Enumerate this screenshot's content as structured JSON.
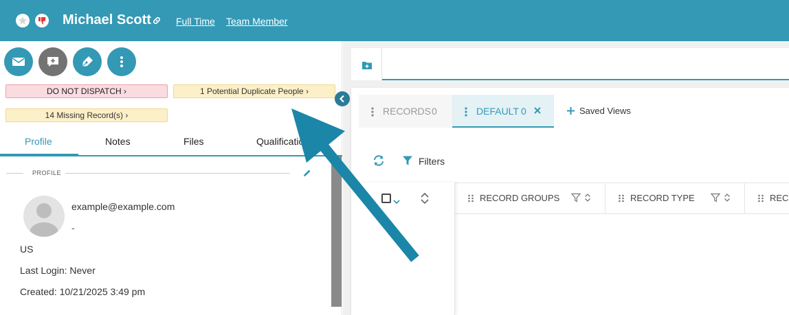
{
  "header": {
    "name": "Michael Scott",
    "employment": "Full Time",
    "role": "Team Member",
    "accent": "#3399b5"
  },
  "actions": [
    "email",
    "comment",
    "edit",
    "more"
  ],
  "badges": {
    "dispatch": "DO NOT DISPATCH",
    "duplicates": "1 Potential Duplicate People",
    "missing": "14 Missing Record(s)"
  },
  "tabs": {
    "profile": "Profile",
    "notes": "Notes",
    "files": "Files",
    "qualifications": "Qualifications"
  },
  "profile": {
    "section": "PROFILE",
    "email": "example@example.com",
    "phone": "-",
    "country": "US",
    "last_login": "Last Login: Never",
    "created": "Created: 10/21/2025 3:49 pm"
  },
  "views": {
    "records_label": "RECORDS",
    "records_count": "0",
    "default_label": "DEFAULT",
    "default_count": "0",
    "saved_views": "Saved Views"
  },
  "toolbar": {
    "filters": "Filters"
  },
  "grid": {
    "columns": [
      "RECORD GROUPS",
      "RECORD TYPE",
      "RECORD"
    ]
  }
}
